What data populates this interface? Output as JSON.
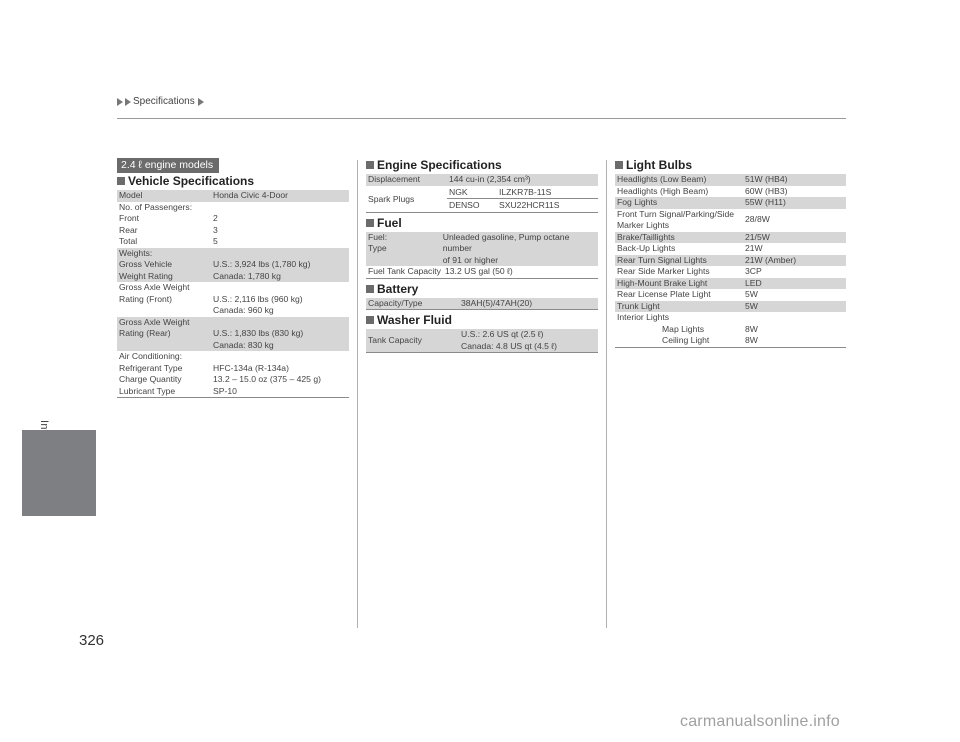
{
  "header": {
    "breadcrumb": "Specifications"
  },
  "sidebar": {
    "section_label": "Information"
  },
  "page_number": "326",
  "watermark": "carmanualsonline.info",
  "engine_badge": "2.4 ℓ engine models",
  "vehicle_specs": {
    "title": "Vehicle Specifications",
    "rows": [
      {
        "label": "Model",
        "value": "Honda Civic 4-Door",
        "shade": true
      },
      {
        "label": "No. of Passengers:",
        "value": "",
        "shade": false
      },
      {
        "label": "Front",
        "value": "2",
        "shade": false
      },
      {
        "label": "Rear",
        "value": "3",
        "shade": false
      },
      {
        "label": "Total",
        "value": "5",
        "shade": false
      },
      {
        "label": "Weights:",
        "value": "",
        "shade": true
      },
      {
        "label": "Gross Vehicle\nWeight Rating",
        "value": "U.S.: 3,924 lbs (1,780 kg)\nCanada: 1,780 kg",
        "shade": true
      },
      {
        "label": "Gross Axle Weight\nRating (Front)",
        "value": "\nU.S.: 2,116 lbs (960 kg)\nCanada: 960 kg",
        "shade": false
      },
      {
        "label": "Gross Axle Weight\nRating (Rear)",
        "value": "\nU.S.: 1,830 lbs (830 kg)\nCanada: 830 kg",
        "shade": true
      },
      {
        "label": "Air Conditioning:",
        "value": "",
        "shade": false
      },
      {
        "label": "Refrigerant Type",
        "value": "HFC-134a (R-134a)",
        "shade": false
      },
      {
        "label": "Charge Quantity",
        "value": "13.2 – 15.0 oz (375 – 425 g)",
        "shade": false
      },
      {
        "label": "Lubricant Type",
        "value": "SP-10",
        "shade": false
      }
    ]
  },
  "engine_specs": {
    "title": "Engine Specifications",
    "displacement_label": "Displacement",
    "displacement_value": "144 cu-in (2,354 cm³)",
    "spark_plugs_label": "Spark Plugs",
    "spark_plugs": [
      {
        "brand": "NGK",
        "part": "ILZKR7B-11S"
      },
      {
        "brand": "DENSO",
        "part": "SXU22HCR11S"
      }
    ]
  },
  "fuel": {
    "title": "Fuel",
    "rows": [
      {
        "label": "Fuel:\nType",
        "value": "Unleaded gasoline, Pump octane number\nof 91 or higher",
        "shade": true
      },
      {
        "label": "Fuel Tank Capacity",
        "value": "13.2 US gal (50 ℓ)",
        "shade": false
      }
    ]
  },
  "battery": {
    "title": "Battery",
    "rows": [
      {
        "label": "Capacity/Type",
        "value": "38AH(5)/47AH(20)",
        "shade": true
      }
    ]
  },
  "washer_fluid": {
    "title": "Washer Fluid",
    "rows": [
      {
        "label": "Tank Capacity",
        "value": "U.S.: 2.6 US qt (2.5 ℓ)\nCanada: 4.8 US qt (4.5 ℓ)",
        "shade": true
      }
    ]
  },
  "light_bulbs": {
    "title": "Light Bulbs",
    "rows": [
      {
        "label": "Headlights (Low Beam)",
        "value": "51W (HB4)",
        "shade": true
      },
      {
        "label": "Headlights (High Beam)",
        "value": "60W (HB3)",
        "shade": false
      },
      {
        "label": "Fog Lights",
        "value": "55W (H11)",
        "shade": true
      },
      {
        "label": "Front Turn Signal/Parking/Side\nMarker Lights",
        "value": "28/8W",
        "shade": false
      },
      {
        "label": "Brake/Taillights",
        "value": "21/5W",
        "shade": true
      },
      {
        "label": "Back-Up Lights",
        "value": "21W",
        "shade": false
      },
      {
        "label": "Rear Turn Signal Lights",
        "value": "21W (Amber)",
        "shade": true
      },
      {
        "label": "Rear Side Marker Lights",
        "value": "3CP",
        "shade": false
      },
      {
        "label": "High-Mount Brake Light",
        "value": "LED",
        "shade": true
      },
      {
        "label": "Rear License Plate Light",
        "value": "5W",
        "shade": false
      },
      {
        "label": "Trunk Light",
        "value": "5W",
        "shade": true
      },
      {
        "label": "Interior Lights",
        "value": "",
        "shade": false
      },
      {
        "label": "Map Lights",
        "value": "8W",
        "shade": false,
        "indent": true
      },
      {
        "label": "Ceiling Light",
        "value": "8W",
        "shade": false,
        "indent": true
      }
    ]
  }
}
